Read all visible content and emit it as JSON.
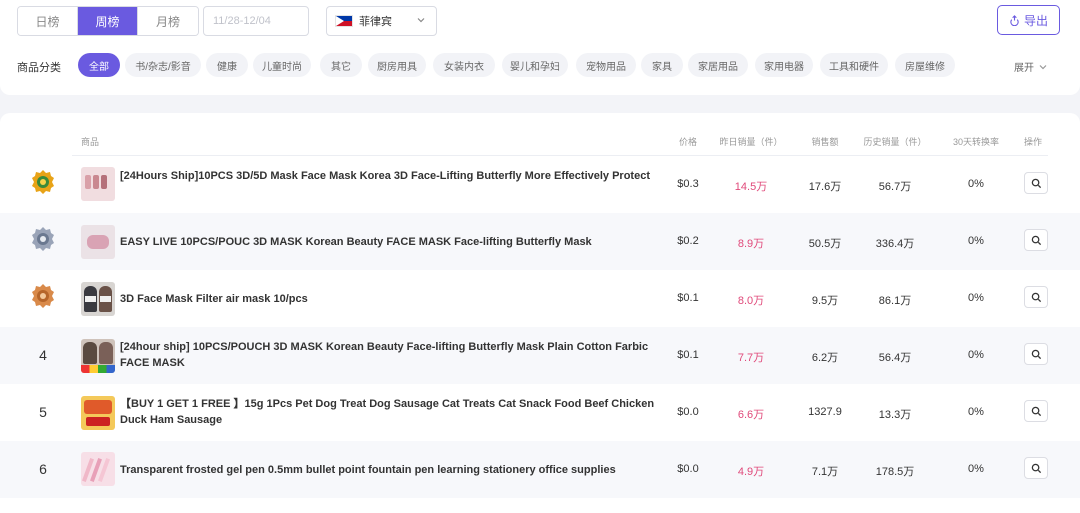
{
  "period_tabs": [
    "日榜",
    "周榜",
    "月榜"
  ],
  "active_period": "周榜",
  "date_range": "11/28-12/04",
  "country": "菲律宾",
  "export_label": "导出",
  "category_label": "商品分类",
  "categories": [
    "全部",
    "书/杂志/影音",
    "健康",
    "儿童时尚",
    "其它",
    "厨房用具",
    "女装内衣",
    "婴儿和孕妇",
    "宠物用品",
    "家具",
    "家居用品",
    "家用电器",
    "工具和硬件",
    "房屋维修"
  ],
  "active_category": "全部",
  "expand_label": "展开",
  "columns": {
    "product": "商品",
    "price": "价格",
    "yesterday_sales": "昨日销量（件）",
    "revenue": "销售额",
    "total_sales": "历史销量（件）",
    "conversion": "30天转换率",
    "action": "操作"
  },
  "rows": [
    {
      "rank": "1",
      "medal": "gold",
      "title": "[24Hours Ship]10PCS 3D/5D Mask Face Mask Korea 3D Face-Lifting Butterfly More Effectively Protect",
      "price": "$0.3",
      "yesterday": "14.5万",
      "revenue": "17.6万",
      "total": "56.7万",
      "conversion": "0%",
      "thumb_color": "#e8c8cc"
    },
    {
      "rank": "2",
      "medal": "silver",
      "title": "EASY LIVE 10PCS/POUC 3D MASK Korean Beauty FACE MASK Face-lifting Butterfly Mask",
      "price": "$0.2",
      "yesterday": "8.9万",
      "revenue": "50.5万",
      "total": "336.4万",
      "conversion": "0%",
      "thumb_color": "#d9a3b4"
    },
    {
      "rank": "3",
      "medal": "bronze",
      "title": "3D Face Mask Filter air mask 10/pcs",
      "price": "$0.1",
      "yesterday": "8.0万",
      "revenue": "9.5万",
      "total": "86.1万",
      "conversion": "0%",
      "thumb_color": "#4a4a52"
    },
    {
      "rank": "4",
      "medal": "",
      "title": "[24hour ship] 10PCS/POUCH 3D MASK Korean Beauty Face-lifting Butterfly Mask Plain Cotton Farbic FACE MASK",
      "price": "$0.1",
      "yesterday": "7.7万",
      "revenue": "6.2万",
      "total": "56.4万",
      "conversion": "0%",
      "thumb_color": "#7a6058"
    },
    {
      "rank": "5",
      "medal": "",
      "title": "【BUY 1 GET 1 FREE 】15g 1Pcs Pet Dog Treat Dog Sausage Cat Treats Cat Snack Food Beef Chicken Duck Ham Sausage",
      "price": "$0.0",
      "yesterday": "6.6万",
      "revenue": "1327.9",
      "total": "13.3万",
      "conversion": "0%",
      "thumb_color": "#e05a2a"
    },
    {
      "rank": "6",
      "medal": "",
      "title": "Transparent frosted gel pen 0.5mm bullet point fountain pen learning stationery office supplies",
      "price": "$0.0",
      "yesterday": "4.9万",
      "revenue": "7.1万",
      "total": "178.5万",
      "conversion": "0%",
      "thumb_color": "#f0b8c8"
    }
  ],
  "colors": {
    "accent": "#6a5ae0",
    "sales_pink": "#e0497a",
    "gold": "#e8a317",
    "silver": "#9aa4b8",
    "bronze": "#d98a4a"
  },
  "icons": {
    "export": "export-icon",
    "chevron": "chevron-down-icon",
    "search": "search-icon"
  }
}
